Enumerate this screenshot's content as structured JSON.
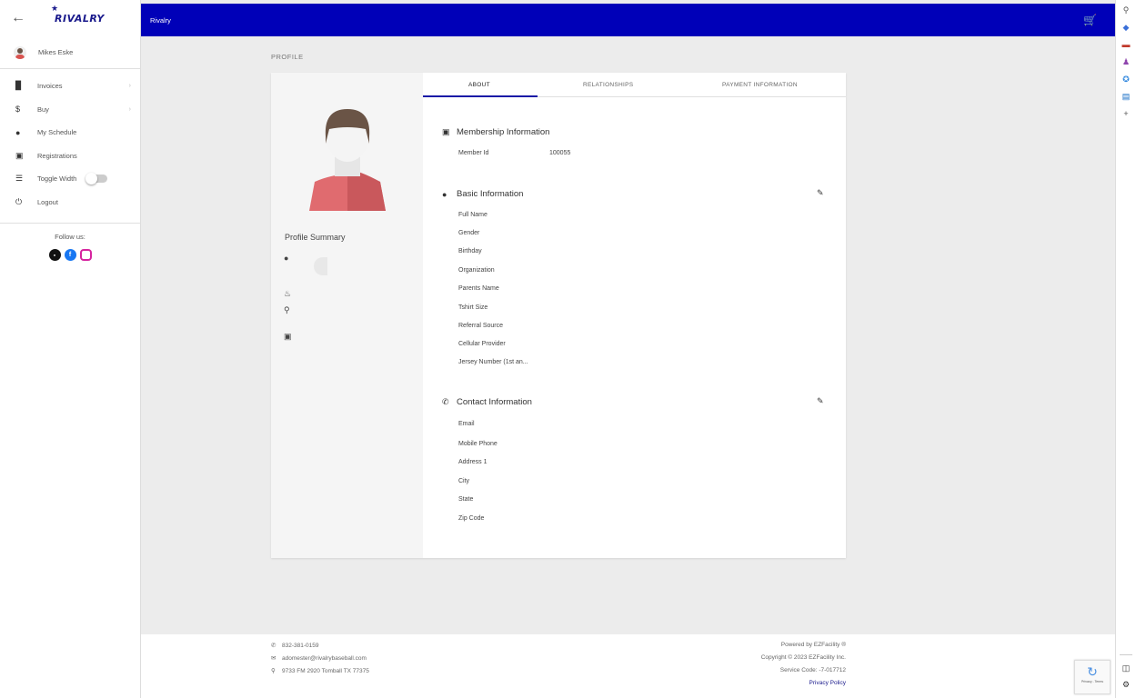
{
  "sidebar": {
    "back_icon": "arrow-left-icon",
    "logo_text": "RIVALRY",
    "user_name": "Mikes Eske",
    "menu": [
      {
        "label": "Invoices",
        "icon": "invoice-icon",
        "has_chevron": true
      },
      {
        "label": "Buy",
        "icon": "dollar-icon",
        "has_chevron": true
      },
      {
        "label": "My Schedule",
        "icon": "person-icon",
        "has_chevron": false
      },
      {
        "label": "Registrations",
        "icon": "id-card-icon",
        "has_chevron": false
      },
      {
        "label": "Toggle Width",
        "icon": "indent-icon",
        "has_chevron": false
      },
      {
        "label": "Logout",
        "icon": "power-icon",
        "has_chevron": false
      }
    ],
    "follow_label": "Follow us:"
  },
  "topbar": {
    "title": "Rivalry",
    "cart_icon": "cart-icon",
    "background": "#0000b8"
  },
  "main": {
    "page_title": "PROFILE",
    "summary_title": "Profile Summary",
    "tabs": [
      {
        "label": "ABOUT",
        "active": true
      },
      {
        "label": "RELATIONSHIPS",
        "active": false
      },
      {
        "label": "PAYMENT INFORMATION",
        "active": false
      }
    ],
    "membership": {
      "title": "Membership Information",
      "fields": [
        {
          "label": "Member Id",
          "value": "100055"
        }
      ]
    },
    "basic": {
      "title": "Basic Information",
      "fields": [
        "Full Name",
        "Gender",
        "Birthday",
        "Organization",
        "Parents Name",
        "Tshirt Size",
        "Referral Source",
        "Cellular Provider",
        "Jersey Number (1st an..."
      ]
    },
    "contact": {
      "title": "Contact Information",
      "fields": [
        "Email",
        "Mobile Phone",
        "Address 1",
        "City",
        "State",
        "Zip Code"
      ]
    }
  },
  "footer": {
    "phone": "832-381-0159",
    "email": "adomester@rivalrybaseball.com",
    "address": "9733 FM 2920 Tomball TX 77375",
    "powered": "Powered by EZFacility ®",
    "copyright": "Copyright © 2023 EZFacility Inc.",
    "service_code": "Service Code: -7-017712",
    "privacy": "Privacy Policy",
    "recaptcha_text": "Privacy - Terms"
  },
  "colors": {
    "brand": "#0000b8",
    "accent": "#1a1aa6",
    "avatar_shirt": "#d9534f"
  }
}
